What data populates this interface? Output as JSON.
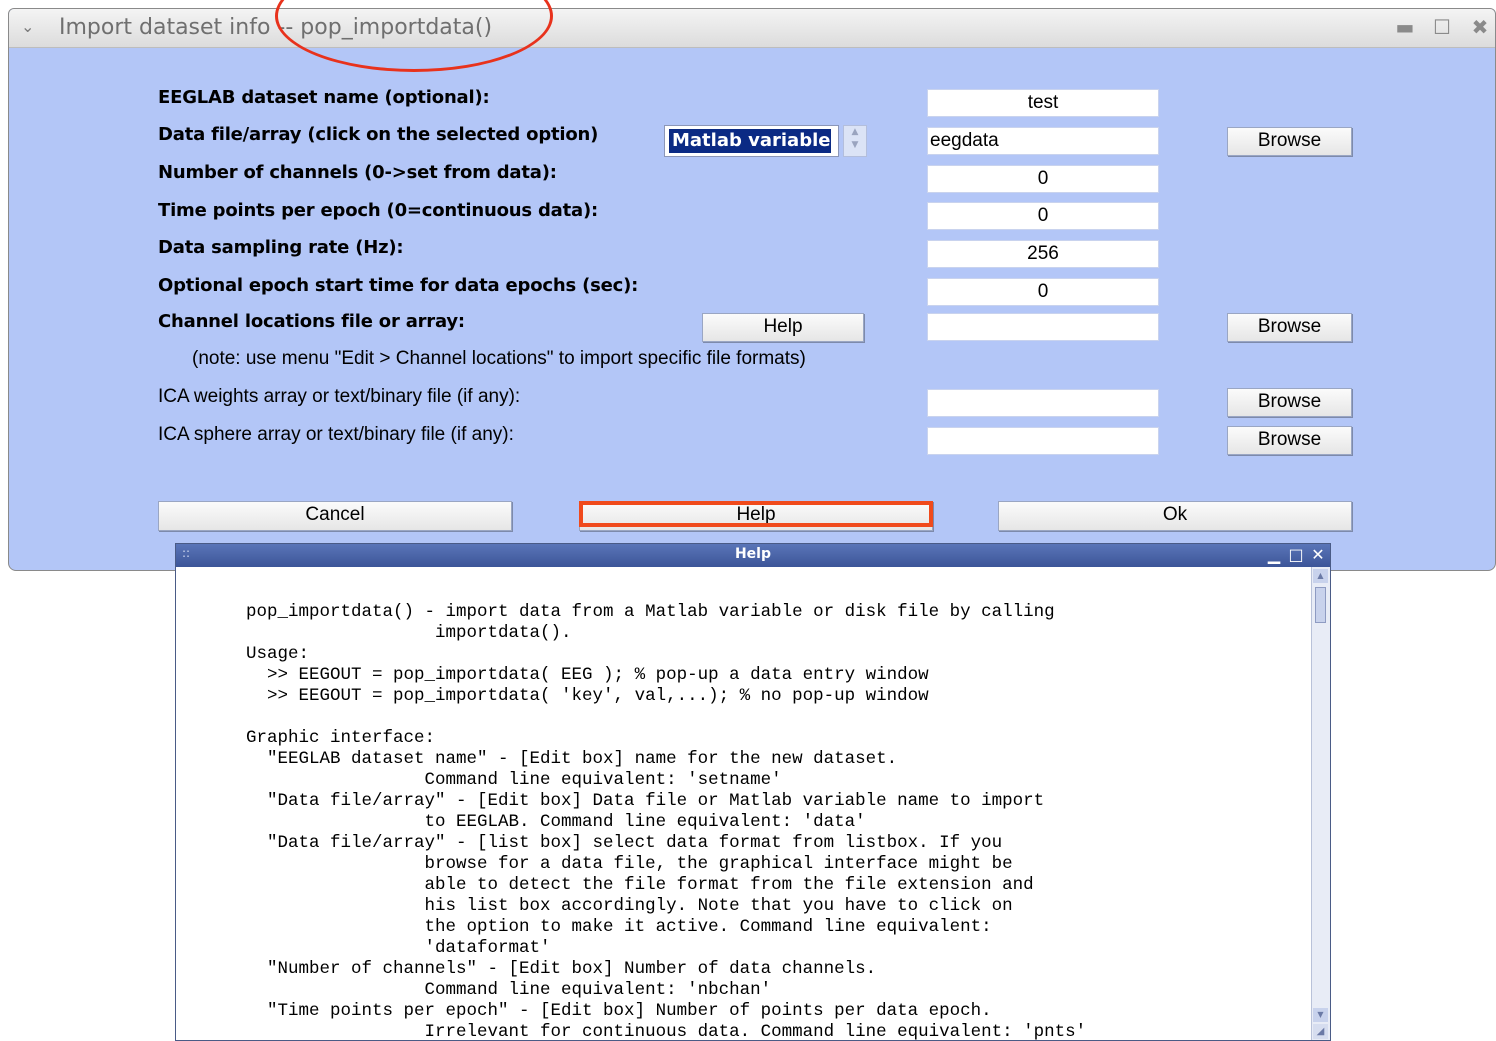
{
  "window": {
    "title": "Import dataset info -- pop_importdata()",
    "controls": {
      "minimize": "▬",
      "maximize": "☐",
      "close": "✖"
    }
  },
  "form": {
    "rows": [
      {
        "label": "EEGLAB dataset name (optional):",
        "value": "test"
      },
      {
        "label": "Data file/array (click on the selected option)",
        "value": "eegdata",
        "select": "Matlab variable",
        "browse": "Browse"
      },
      {
        "label": "Number of channels (0->set from data):",
        "value": "0"
      },
      {
        "label": "Time points per epoch (0=continuous data):",
        "value": "0"
      },
      {
        "label": "Data sampling rate (Hz):",
        "value": "256"
      },
      {
        "label": "Optional epoch start time for data epochs (sec):",
        "value": "0"
      },
      {
        "label": "Channel locations file or array:",
        "value": "",
        "help": "Help",
        "browse": "Browse"
      },
      {
        "label": "ICA weights array or text/binary file (if any):",
        "value": "",
        "browse": "Browse"
      },
      {
        "label": "ICA sphere array or text/binary file (if any):",
        "value": "",
        "browse": "Browse"
      }
    ],
    "note": "(note: use menu \"Edit > Channel locations\" to import specific file formats)"
  },
  "footer": {
    "cancel": "Cancel",
    "help": "Help",
    "ok": "Ok"
  },
  "annotations": {
    "color": "#e8321c"
  },
  "help_window": {
    "title": "Help",
    "grip": "::",
    "controls": {
      "minimize": "▁",
      "maximize": "□",
      "close": "✕"
    },
    "text": "pop_importdata() - import data from a Matlab variable or disk file by calling\n                  importdata().\nUsage:\n  >> EEGOUT = pop_importdata( EEG ); % pop-up a data entry window\n  >> EEGOUT = pop_importdata( 'key', val,...); % no pop-up window\n\nGraphic interface:\n  \"EEGLAB dataset name\" - [Edit box] name for the new dataset.\n                 Command line equivalent: 'setname'\n  \"Data file/array\" - [Edit box] Data file or Matlab variable name to import\n                 to EEGLAB. Command line equivalent: 'data'\n  \"Data file/array\" - [list box] select data format from listbox. If you\n                 browse for a data file, the graphical interface might be\n                 able to detect the file format from the file extension and\n                 his list box accordingly. Note that you have to click on\n                 the option to make it active. Command line equivalent:\n                 'dataformat'\n  \"Number of channels\" - [Edit box] Number of data channels.\n                 Command line equivalent: 'nbchan'\n  \"Time points per epoch\" - [Edit box] Number of points per data epoch.\n                 Irrelevant for continuous data. Command line equivalent: 'pnts'"
  }
}
